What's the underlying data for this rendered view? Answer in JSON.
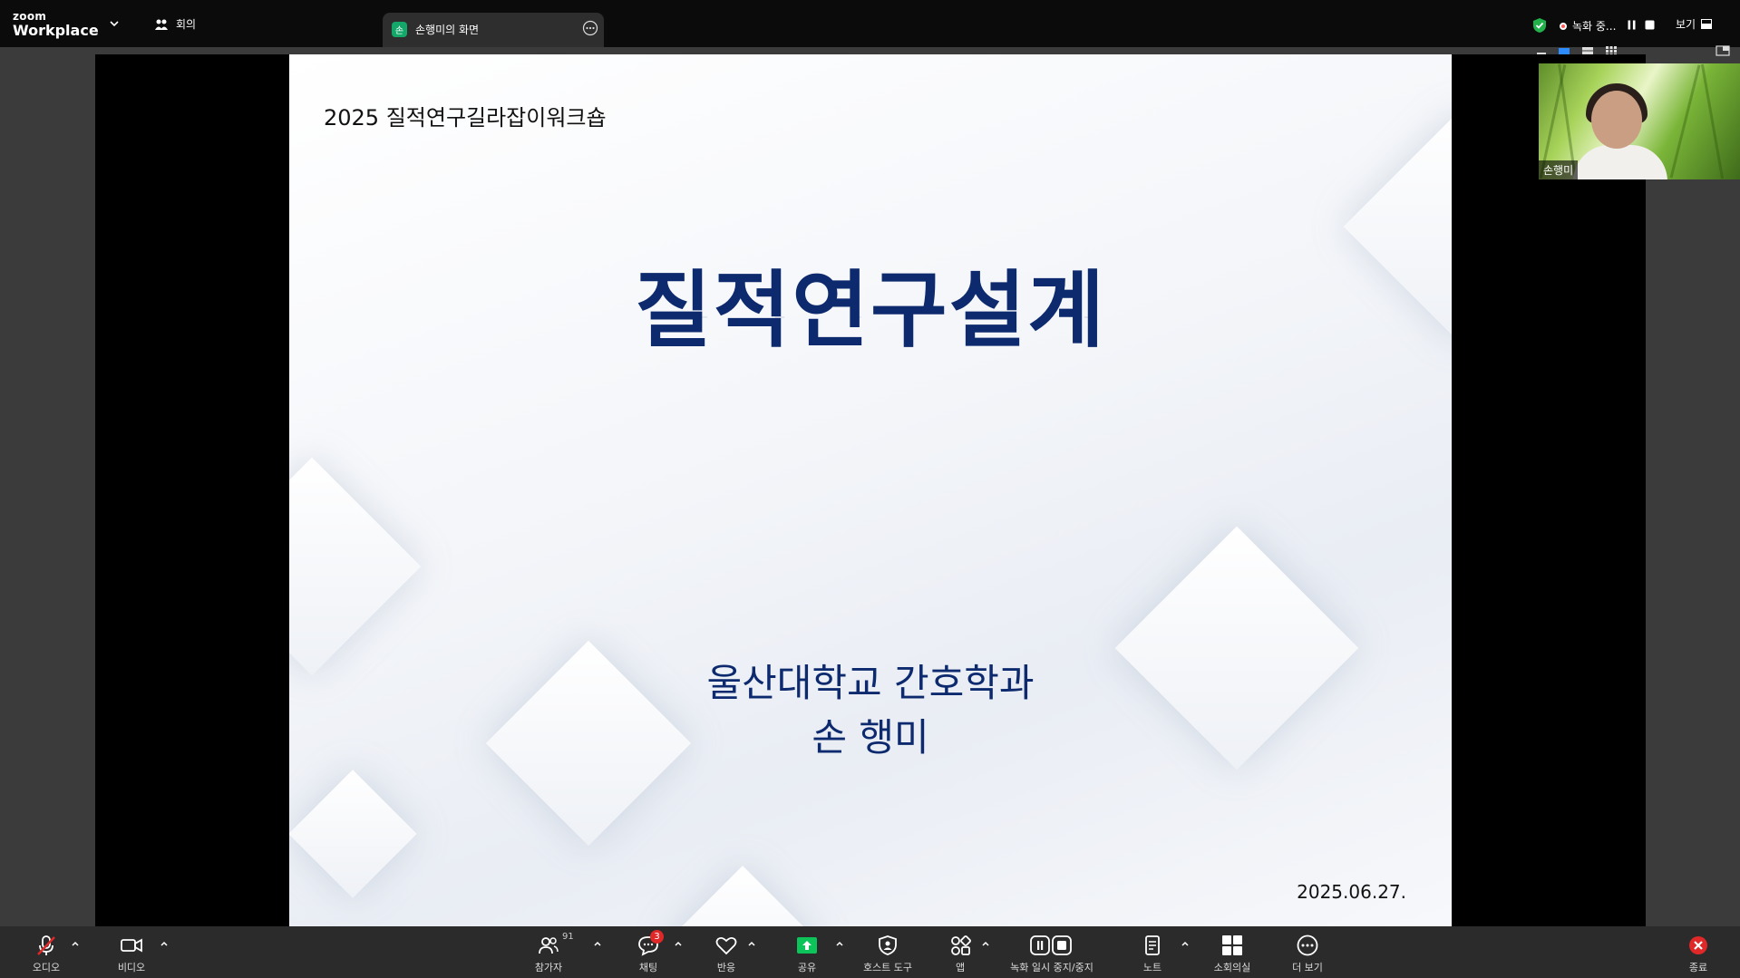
{
  "app": {
    "brand_top": "zoom",
    "brand_bottom": "Workplace"
  },
  "tabs": {
    "meeting_label": "회의",
    "share_label": "손행미의 화면",
    "share_avatar": "손"
  },
  "status": {
    "recording_text": "녹화 중...",
    "view_label": "보기"
  },
  "slide": {
    "top_title": "2025 질적연구길라잡이워크숍",
    "main_title": "질적연구설계",
    "subtitle_line1": "울산대학교 간호학과",
    "subtitle_line2": "손 행미",
    "date": "2025.06.27."
  },
  "self_view": {
    "name": "손행미"
  },
  "toolbar": {
    "audio": "오디오",
    "video": "비디오",
    "participants": "참가자",
    "participants_count": "91",
    "chat": "채팅",
    "chat_badge": "3",
    "reactions": "반응",
    "share": "공유",
    "host_tools": "호스트 도구",
    "apps": "앱",
    "record": "녹화 일시 중지/중지",
    "notes": "노트",
    "breakout": "소회의실",
    "more": "더 보기",
    "end": "종료"
  },
  "colors": {
    "accent_green": "#13a86a",
    "share_green": "#0cc45a",
    "end_red": "#e02828",
    "slide_title": "#0d2a6e"
  }
}
